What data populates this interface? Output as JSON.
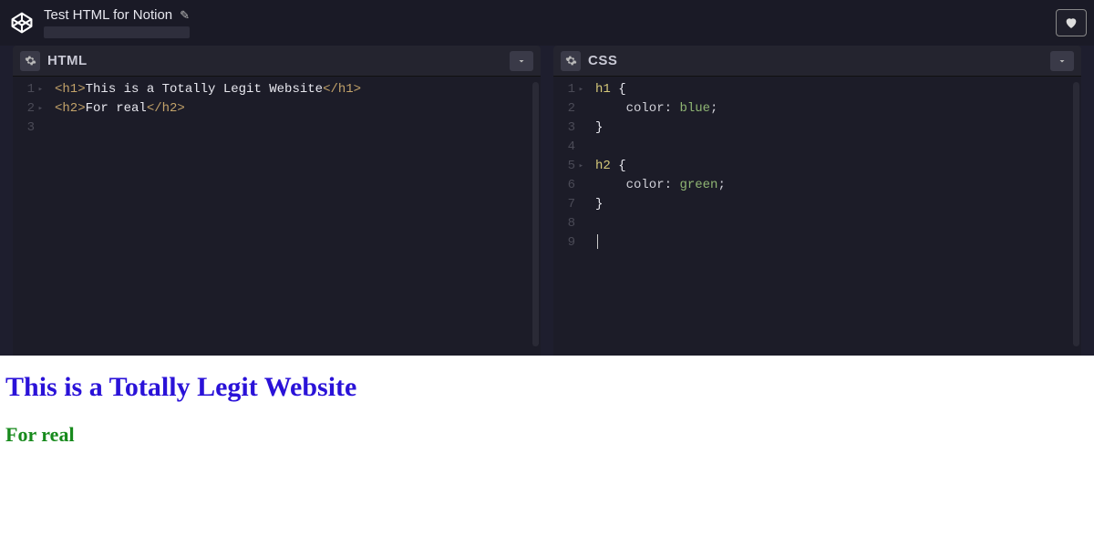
{
  "header": {
    "pen_title": "Test HTML for Notion"
  },
  "panels": {
    "html": {
      "title": "HTML",
      "lines": [
        "1",
        "2",
        "3"
      ],
      "code": {
        "l1_open": "<h1>",
        "l1_text": "This is a Totally Legit Website",
        "l1_close": "</h1>",
        "l2_open": "<h2>",
        "l2_text": "For real",
        "l2_close": "</h2>"
      }
    },
    "css": {
      "title": "CSS",
      "lines": [
        "1",
        "2",
        "3",
        "4",
        "5",
        "6",
        "7",
        "8",
        "9"
      ],
      "code": {
        "l1_sel": "h1",
        "l1_brace": " {",
        "l2_prop": "    color",
        "l2_colon": ": ",
        "l2_val": "blue",
        "l2_semi": ";",
        "l3_brace": "}",
        "l5_sel": "h2",
        "l5_brace": " {",
        "l6_prop": "    color",
        "l6_colon": ": ",
        "l6_val": "green",
        "l6_semi": ";",
        "l7_brace": "}"
      }
    }
  },
  "preview": {
    "h1": "This is a Totally Legit Website",
    "h2": "For real"
  }
}
